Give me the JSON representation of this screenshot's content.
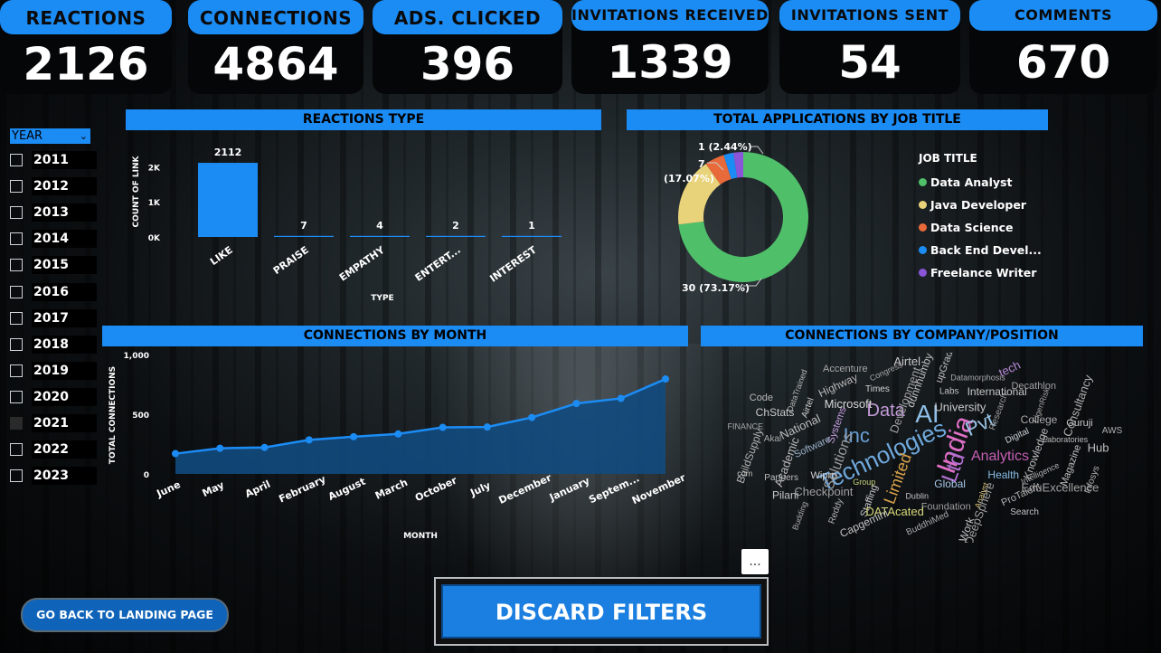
{
  "kpis": [
    {
      "title": "REACTIONS",
      "value": "2126"
    },
    {
      "title": "CONNECTIONS",
      "value": "4864"
    },
    {
      "title": "ADS. CLICKED",
      "value": "396"
    },
    {
      "title": "INVITATIONS RECEIVED",
      "value": "1339"
    },
    {
      "title": "INVITATIONS SENT",
      "value": "54"
    },
    {
      "title": "COMMENTS",
      "value": "670"
    }
  ],
  "year_slicer": {
    "header": "YEAR",
    "years": [
      {
        "label": "2011",
        "selected": false
      },
      {
        "label": "2012",
        "selected": false
      },
      {
        "label": "2013",
        "selected": false
      },
      {
        "label": "2014",
        "selected": false
      },
      {
        "label": "2015",
        "selected": false
      },
      {
        "label": "2016",
        "selected": false
      },
      {
        "label": "2017",
        "selected": false
      },
      {
        "label": "2018",
        "selected": false
      },
      {
        "label": "2019",
        "selected": false
      },
      {
        "label": "2020",
        "selected": false
      },
      {
        "label": "2021",
        "selected": true
      },
      {
        "label": "2022",
        "selected": false
      },
      {
        "label": "2023",
        "selected": false
      }
    ]
  },
  "sections": {
    "reactions_type": "REACTIONS TYPE",
    "applications": "TOTAL APPLICATIONS BY JOB TITLE",
    "connections_month": "CONNECTIONS BY MONTH",
    "connections_company": "CONNECTIONS BY COMPANY/POSITION"
  },
  "legend": {
    "title": "JOB TITLE",
    "items": [
      {
        "label": "Data Analyst",
        "color": "#4fbf6a"
      },
      {
        "label": "Java Developer",
        "color": "#e8d27a"
      },
      {
        "label": "Data Science",
        "color": "#e8693a"
      },
      {
        "label": "Back End Devel...",
        "color": "#1c8cf5"
      },
      {
        "label": "Freelance Writer",
        "color": "#8a55d9"
      }
    ]
  },
  "donut_labels": {
    "top": "1 (2.44%)",
    "left_a": "7",
    "left_b": "(17.07%)",
    "bottom": "30 (73.17%)"
  },
  "chart_data": [
    {
      "type": "bar",
      "title": "REACTIONS TYPE",
      "xlabel": "TYPE",
      "ylabel": "COUNT OF LINK",
      "categories": [
        "LIKE",
        "PRAISE",
        "EMPATHY",
        "ENTERT...",
        "INTEREST"
      ],
      "values": [
        2112,
        7,
        4,
        2,
        1
      ],
      "ylim": [
        0,
        2500
      ],
      "yticks": [
        "0K",
        "1K",
        "2K"
      ],
      "color": "#1c8cf5"
    },
    {
      "type": "pie",
      "title": "TOTAL APPLICATIONS BY JOB TITLE",
      "categories": [
        "Data Analyst",
        "Java Developer",
        "Data Science",
        "Back End Devel...",
        "Freelance Writer"
      ],
      "values": [
        30,
        7,
        2,
        1,
        1
      ]
    },
    {
      "type": "area",
      "title": "CONNECTIONS BY MONTH",
      "xlabel": "MONTH",
      "ylabel": "TOTAL CONNECTIONS",
      "categories": [
        "June",
        "May",
        "April",
        "February",
        "August",
        "March",
        "October",
        "July",
        "December",
        "January",
        "Septem...",
        "November"
      ],
      "values": [
        170,
        215,
        222,
        285,
        312,
        335,
        390,
        393,
        473,
        590,
        633,
        795
      ],
      "ylim": [
        0,
        1000
      ],
      "yticks": [
        "0",
        "500",
        "1,000"
      ],
      "color": "#1c8cf5"
    }
  ],
  "wordcloud": {
    "words": [
      {
        "t": "India",
        "c": "#e070c8"
      },
      {
        "t": "Technologies",
        "c": "#6fa8dc"
      },
      {
        "t": "AI",
        "c": "#8fbfe8"
      },
      {
        "t": "Ltd",
        "c": "#b06fd0"
      },
      {
        "t": "Inc",
        "c": "#6aa0d8"
      },
      {
        "t": "Pvt",
        "c": "#9bc4e6"
      },
      {
        "t": "Limited",
        "c": "#d9a24a"
      },
      {
        "t": "Data",
        "c": "#c29bd6"
      },
      {
        "t": "Analytics",
        "c": "#c45fb4"
      },
      {
        "t": "Solutions",
        "c": "#9a9a9a"
      },
      {
        "t": "University",
        "c": "#c8c8c8"
      },
      {
        "t": "Global",
        "c": "#a6c7e8"
      },
      {
        "t": "Systems",
        "c": "#c79ee0"
      },
      {
        "t": "Digital",
        "c": "#cdd6de"
      },
      {
        "t": "Group",
        "c": "#c5d27a"
      },
      {
        "t": "Development",
        "c": "#a0a0a0"
      },
      {
        "t": "Health",
        "c": "#88bde8"
      },
      {
        "t": "Software",
        "c": "#9ab0c8"
      },
      {
        "t": "Research",
        "c": "#9a9a9a"
      },
      {
        "t": "Dublin",
        "c": "#c4c4c4"
      },
      {
        "t": "Microsoft",
        "c": "#d8d8d8"
      },
      {
        "t": "Knowledge",
        "c": "#b8b8b8"
      },
      {
        "t": "Wipro",
        "c": "#d0d0d0"
      },
      {
        "t": "Labs",
        "c": "#c0c0c0"
      },
      {
        "t": "Analyst",
        "c": "#d8c27a"
      },
      {
        "t": "National",
        "c": "#bcbcbc"
      },
      {
        "t": "College",
        "c": "#a8a8a8"
      },
      {
        "t": "Staffing",
        "c": "#c8c8c8"
      },
      {
        "t": "Times",
        "c": "#d4d4d4"
      },
      {
        "t": "Intelligence",
        "c": "#b0b0b0"
      },
      {
        "t": "Academic",
        "c": "#bcbcbc"
      },
      {
        "t": "International",
        "c": "#c8c8c8"
      },
      {
        "t": "Foundation",
        "c": "#9c9c9c"
      },
      {
        "t": "Airtel",
        "c": "#d0d0d0"
      },
      {
        "t": "Laboratories",
        "c": "#b8b8b8"
      },
      {
        "t": "Checkpoint",
        "c": "#a0a0a0"
      },
      {
        "t": "dunnhumby",
        "c": "#c0c0c0"
      },
      {
        "t": "ProTalent",
        "c": "#b0b0b0"
      },
      {
        "t": "Akal",
        "c": "#a8a8a8"
      },
      {
        "t": "EigenRisk",
        "c": "#a0a0a0"
      },
      {
        "t": "DATAcated",
        "c": "#d8d87a"
      },
      {
        "t": "Highway",
        "c": "#b8b8b8"
      },
      {
        "t": "Magazine",
        "c": "#c0c0c0"
      },
      {
        "t": "Partners",
        "c": "#bcbcbc"
      },
      {
        "t": "Datamorphosis",
        "c": "#a8a8a8"
      },
      {
        "t": "DeepSphere",
        "c": "#a0a0a0"
      },
      {
        "t": "ChStats",
        "c": "#c8c8c8"
      },
      {
        "t": "Guruji",
        "c": "#c8c8c8"
      },
      {
        "t": "Reddy",
        "c": "#b0b0b0"
      },
      {
        "t": "Congress",
        "c": "#a8a8a8"
      },
      {
        "t": "EduExcellence",
        "c": "#a0a0a0"
      },
      {
        "t": "BuildSupply",
        "c": "#b0b0b0"
      },
      {
        "t": "Decathlon",
        "c": "#a0a0a0"
      },
      {
        "t": "BuddhiMed",
        "c": "#a8a8a8"
      },
      {
        "t": "DataTrained",
        "c": "#b8b8b8"
      },
      {
        "t": "Hub",
        "c": "#c0c0c0"
      },
      {
        "t": "Pilani",
        "c": "#c8c8c8"
      },
      {
        "t": "upGrad",
        "c": "#c0c0c0"
      },
      {
        "t": "Search",
        "c": "#c0c0c0"
      },
      {
        "t": "FINANCE",
        "c": "#a8a8a8"
      },
      {
        "t": "Consultancy",
        "c": "#b0b0b0"
      },
      {
        "t": "Capgemini",
        "c": "#c0c0c0"
      },
      {
        "t": "Accenture",
        "c": "#a8a8a8"
      },
      {
        "t": "Infosys",
        "c": "#b0b0b0"
      },
      {
        "t": "com",
        "c": "#c8c8c8"
      },
      {
        "t": "tech",
        "c": "#b88ad8"
      },
      {
        "t": "Work",
        "c": "#c0c0c0"
      },
      {
        "t": "Code",
        "c": "#b8b8b8"
      },
      {
        "t": "AWS",
        "c": "#b0b0b0"
      },
      {
        "t": "Budding",
        "c": "#a8a8a8"
      },
      {
        "t": "Airtel",
        "c": "#c8c8c8"
      }
    ]
  },
  "buttons": {
    "back": "GO BACK TO LANDING PAGE",
    "discard": "DISCARD FILTERS",
    "more": "..."
  }
}
